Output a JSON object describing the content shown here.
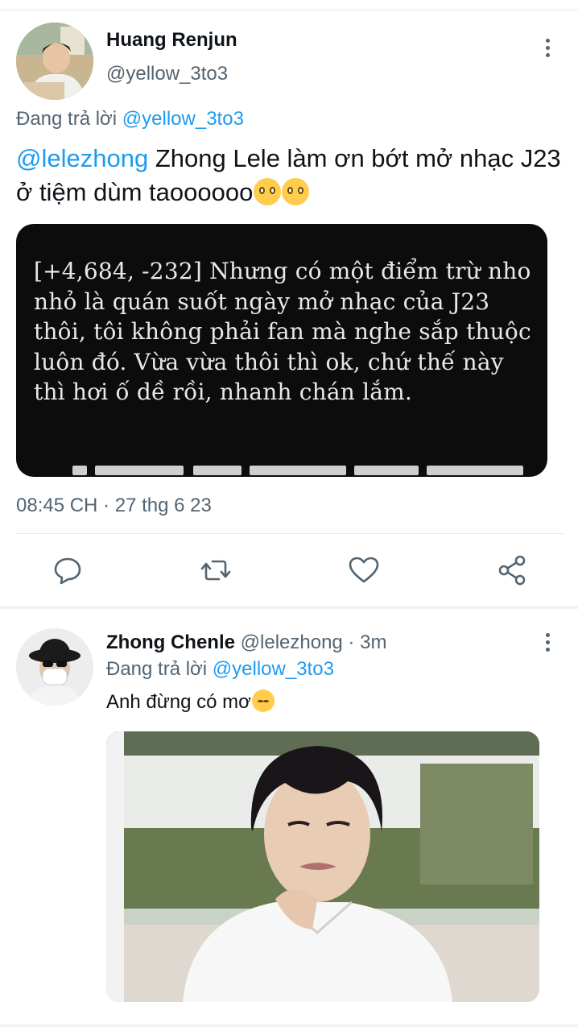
{
  "main_tweet": {
    "author_name": "Huang Renjun",
    "author_handle": "@yellow_3to3",
    "replying_prefix": "Đang trả lời ",
    "replying_to": "@yellow_3to3",
    "mention": "@lelezhong",
    "text": " Zhong Lele làm ơn bớt mở nhạc J23 ở tiệm dùm taoooooo",
    "emojis": [
      "slightly-smiling-face",
      "slightly-smiling-face"
    ],
    "quoted_image_text": "[+4,684, -232] Nhưng có một điểm trừ nho nhỏ là quán suốt ngày mở nhạc của J23 thôi, tôi không phải fan mà nghe sắp thuộc luôn đó. Vừa vừa thôi thì ok, chứ thế này thì hơi ố dề rồi, nhanh chán lắm.",
    "timestamp": "08:45 CH · 27 thg 6 23",
    "actions": [
      "reply-icon",
      "retweet-icon",
      "like-icon",
      "share-icon"
    ]
  },
  "reply_tweet": {
    "author_name": "Zhong Chenle",
    "meta": " @lelezhong · 3m",
    "replying_prefix": "Đang trả lời ",
    "replying_to": "@yellow_3to3",
    "text": "Anh đừng có mơ",
    "emoji": "smirking-face"
  },
  "colors": {
    "link": "#1d9bf0",
    "secondary_text": "#536471",
    "divider": "#e1e8ed"
  }
}
